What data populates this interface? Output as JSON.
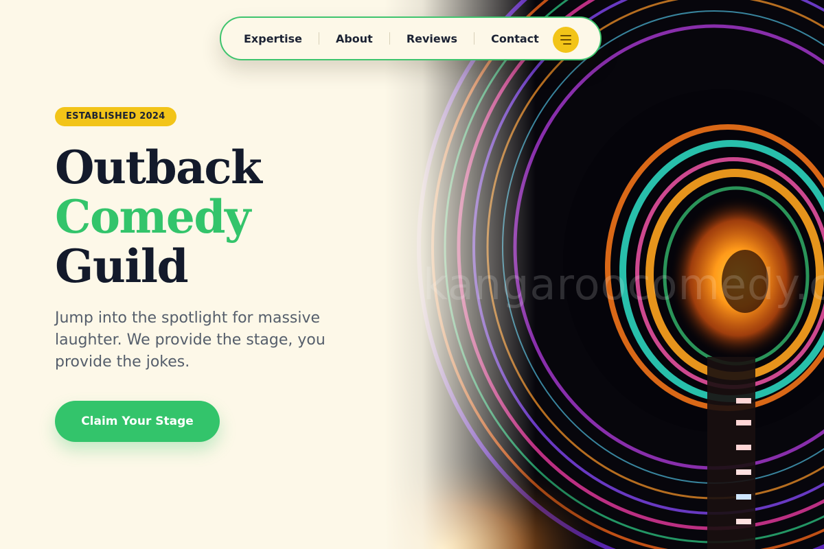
{
  "nav": {
    "items": [
      {
        "label": "Expertise"
      },
      {
        "label": "About"
      },
      {
        "label": "Reviews"
      },
      {
        "label": "Contact"
      }
    ],
    "menu_icon": "hamburger-menu-icon",
    "accent_color": "#f2c418",
    "border_color": "#3ec46d"
  },
  "hero": {
    "badge": "ESTABLISHED 2024",
    "title_line1": "Outback",
    "title_line2": "Comedy",
    "title_line3": "Guild",
    "subtitle": "Jump into the spotlight for massive laughter. We provide the stage, you provide the jokes.",
    "cta_label": "Claim Your Stage",
    "watermark": "kangaroocomedy.com"
  },
  "colors": {
    "background": "#fdf8e8",
    "primary_green": "#33c46b",
    "badge_yellow": "#f2c418",
    "heading_dark": "#131a2b",
    "body_text": "#555e6b"
  }
}
